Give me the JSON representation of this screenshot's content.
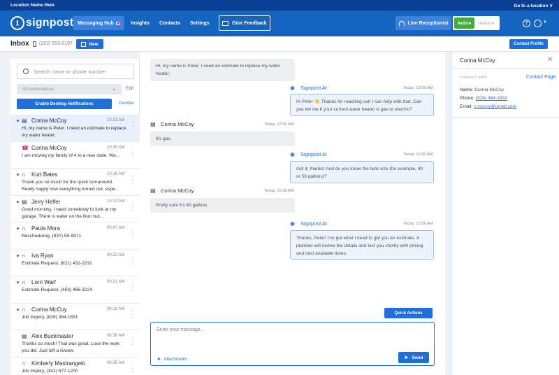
{
  "topbar": {
    "location": "Location Name Here",
    "goto": "Go to a location ∨"
  },
  "nav": {
    "logo": "signpost",
    "items": [
      "Messaging Hub",
      "Insights",
      "Contacts",
      "Settings"
    ],
    "feedback": "Give Feedback",
    "live_receptionist": "Live Receptionist",
    "toggle_on": "Active",
    "toggle_off": "Inactive"
  },
  "subbar": {
    "title": "Inbox",
    "phone": "(202) 555-0197",
    "new_label": "New",
    "contact_profile": "Contact Profile"
  },
  "sidebar": {
    "search_placeholder": "Search name or phone number",
    "filter": "All conversations",
    "edit": "Edit",
    "enable_notifications": "Enable Desktop Notifications",
    "dismiss": "Dismiss",
    "conversations": [
      {
        "name": "Corina McCoy",
        "time": "10:13 AM",
        "msg": "Hi, my name is Peter. I need an estimate to replace my water heater.",
        "icon": "chat-icon",
        "unread": true
      },
      {
        "name": "Corina McCoy",
        "time": "10:39 AM",
        "msg": "I am moving my family of 4 to a new state. We...",
        "icon": "phone-icon",
        "unread": false
      },
      {
        "name": "Kurt Bates",
        "time": "10:18 AM",
        "msg": "Thank you so much for the quick turnaround. Really happy how everything turned out, espe...",
        "icon": "headset-icon",
        "unread": true
      },
      {
        "name": "Jerry Helfer",
        "time": "10:13 AM",
        "msg": "Good morning, I need somebody to look at my garage. There is water on the floor but...",
        "icon": "chat-icon",
        "unread": true
      },
      {
        "name": "Paula Mora",
        "time": "09:47 AM",
        "msg": "Rescheduling, (837) 59-9871",
        "icon": "headset-icon",
        "unread": true
      },
      {
        "name": "Iva Ryan",
        "time": "09:22 AM",
        "msg": "Estimate Request, (821) 432-2231",
        "icon": "headset-icon",
        "unread": true
      },
      {
        "name": "Lorri Warf",
        "time": "09:21 AM",
        "msg": "Estimate Request, (453) 466-3224",
        "icon": "headset-icon",
        "unread": true
      },
      {
        "name": "Corina McCoy",
        "time": "09:19 AM",
        "msg": "Job Inquiry, (826) 364-1831",
        "icon": "headset-icon",
        "unread": true
      },
      {
        "name": "Alex Buckmaster",
        "time": "08:38 AM",
        "msg": "Thanks so much! That was great. Love the work you did. Just left a review.",
        "icon": "chat-icon",
        "unread": false
      },
      {
        "name": "Kimberly Mastrangelo",
        "time": "08:35 AM",
        "msg": "Job Inquiry, (341) 877-1200",
        "icon": "headset-icon",
        "unread": false
      }
    ]
  },
  "chat": {
    "messages": [
      {
        "type": "in",
        "sender": "",
        "time": "",
        "text": "Hi, my name is Peter. I need an estimate to replace my water heater."
      },
      {
        "type": "out",
        "sender": "Signpost AI",
        "time": "Today, 12:00 AM",
        "text": "Hi Peter 👋 Thanks for reaching out! I can help with that. Can you tell me if your current water heater is gas or electric?"
      },
      {
        "type": "in",
        "sender": "Corina McCoy",
        "time": "Today, 12:00 AM",
        "text": "It's gas."
      },
      {
        "type": "out",
        "sender": "Signpost AI",
        "time": "Today, 12:00 AM",
        "text": "Got it, thanks! And do you know the tank size (for example, 40 or 50 gallons)?"
      },
      {
        "type": "in",
        "sender": "Corina McCoy",
        "time": "Today, 12:00 AM",
        "text": "Pretty sure it's 40 gallons"
      },
      {
        "type": "out",
        "sender": "Signpost AI",
        "time": "Today, 12:00 AM",
        "text": "Thanks, Peter! I've got what I need to get you an estimate. A plumber will review the details and text you shortly with pricing and next available times."
      }
    ],
    "quick_actions": "Quick Actions",
    "composer_placeholder": "Enter your message...",
    "attachments": "Attachments",
    "send": "Send"
  },
  "contact": {
    "name": "Corina McCoy",
    "section": "CONTACT INFO",
    "contact_page": "Contact Page",
    "name_label": "Name:",
    "name_value": "Corina McCoy",
    "phone_label": "Phone:",
    "phone_value": "(826) 364-1831",
    "email_label": "Email:",
    "email_value": "c.mccoy@gmail.com"
  },
  "colors": {
    "brand": "#1565c0",
    "topbar": "#0b3f93",
    "accent": "#1e6fd9",
    "active_green": "#3fae3a"
  }
}
